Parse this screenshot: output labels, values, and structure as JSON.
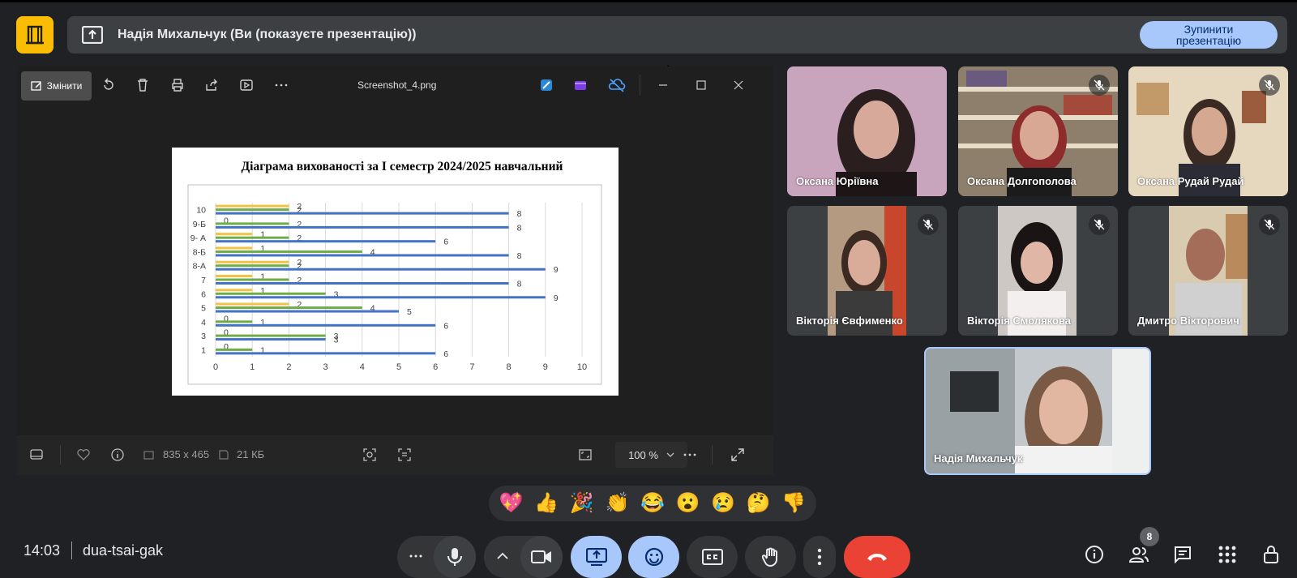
{
  "presenter_bar": {
    "title": "Надія Михальчук (Ви (показуєте презентацію))",
    "stop_button": "Зупинити презентацію"
  },
  "viewer": {
    "edit_label": "Змінити",
    "file_name": "Screenshot_4.png",
    "dimensions": "835 x 465",
    "file_size": "21 КБ",
    "zoom": "100 %"
  },
  "chart_data": {
    "type": "bar",
    "orientation": "horizontal",
    "title": "Діаграма вихованості за І семестр 2024/2025 навчальний",
    "categories": [
      "10",
      "9-Б",
      "9- А",
      "8-Б",
      "8-А",
      "7",
      "6",
      "5",
      "4",
      "3",
      "1"
    ],
    "series": [
      {
        "color": "#f2c244",
        "values": [
          2,
          0,
          1,
          1,
          2,
          1,
          1,
          2,
          0,
          0,
          0
        ]
      },
      {
        "color": "#70ad47",
        "values": [
          2,
          2,
          2,
          4,
          2,
          2,
          3,
          4,
          1,
          3,
          1
        ]
      },
      {
        "color": "#4472c4",
        "values": [
          8,
          8,
          6,
          8,
          9,
          8,
          9,
          5,
          6,
          3,
          6
        ]
      }
    ],
    "xlim": [
      0,
      10
    ],
    "xticks": [
      "0",
      "1",
      "2",
      "3",
      "4",
      "5",
      "6",
      "7",
      "8",
      "9",
      "10"
    ],
    "grid": "vertical"
  },
  "participants": [
    {
      "name": "Оксана Юріївна",
      "muted": false
    },
    {
      "name": "Оксана Долгополова",
      "muted": true
    },
    {
      "name": "Оксана Рудай Рудай",
      "muted": true
    },
    {
      "name": "Вікторія Євфименко",
      "muted": true
    },
    {
      "name": "Вікторія Смолякова",
      "muted": true
    },
    {
      "name": "Дмитро Вікторович",
      "muted": true
    }
  ],
  "self_tile": {
    "name": "Надія Михальчук"
  },
  "reactions": [
    "💖",
    "👍",
    "🎉",
    "👏",
    "😂",
    "😮",
    "😢",
    "🤔",
    "👎"
  ],
  "bottom_bar": {
    "time": "14:03",
    "meeting_code": "dua-tsai-gak",
    "participants_count": "8"
  },
  "colors": {
    "accent_blue": "#a8c7fa",
    "end_call_red": "#ea4335",
    "logo_yellow": "#fbbc04"
  }
}
